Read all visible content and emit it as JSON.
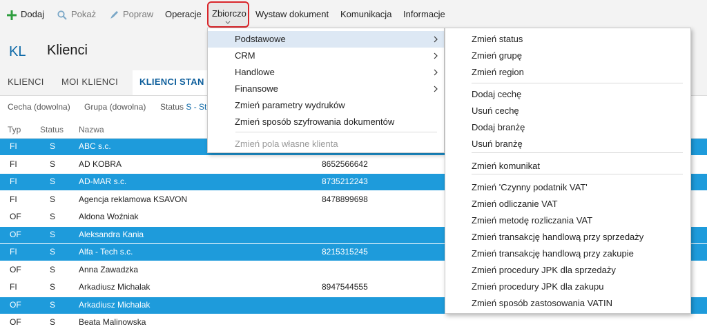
{
  "toolbar": {
    "add_label": "Dodaj",
    "show_label": "Pokaż",
    "edit_label": "Popraw",
    "operations_label": "Operacje",
    "bulk_label": "Zbiorczo",
    "issue_doc_label": "Wystaw dokument",
    "communication_label": "Komunikacja",
    "info_label": "Informacje",
    "add_icon": "plus-icon",
    "show_icon": "search-icon",
    "edit_icon": "pencil-icon",
    "accent_color": "#2e9e3e"
  },
  "header": {
    "badge": "KL",
    "title": "Klienci"
  },
  "tabs": [
    "KLIENCI",
    "MOI KLIENCI",
    "KLIENCI STAN"
  ],
  "filters": {
    "feature": "Cecha (dowolna)",
    "group": "Grupa (dowolna)",
    "status_label": "Status",
    "status_value": "S - St"
  },
  "columns": {
    "type": "Typ",
    "status": "Status",
    "name": "Nazwa"
  },
  "rows": [
    {
      "typ": "FI",
      "status": "S",
      "name": "ABC s.c.",
      "nip": "",
      "selected": true
    },
    {
      "typ": "FI",
      "status": "S",
      "name": "AD KOBRA",
      "nip": "8652566642",
      "selected": false
    },
    {
      "typ": "FI",
      "status": "S",
      "name": "AD-MAR s.c.",
      "nip": "8735212243",
      "selected": true
    },
    {
      "typ": "FI",
      "status": "S",
      "name": "Agencja reklamowa KSAVON",
      "nip": "8478899698",
      "selected": false
    },
    {
      "typ": "OF",
      "status": "S",
      "name": "Aldona Woźniak",
      "nip": "",
      "selected": false
    },
    {
      "typ": "OF",
      "status": "S",
      "name": "Aleksandra Kania",
      "nip": "",
      "selected": true
    },
    {
      "typ": "FI",
      "status": "S",
      "name": "Alfa - Tech s.c.",
      "nip": "8215315245",
      "selected": true
    },
    {
      "typ": "OF",
      "status": "S",
      "name": "Anna Zawadzka",
      "nip": "",
      "selected": false
    },
    {
      "typ": "FI",
      "status": "S",
      "name": "Arkadiusz Michalak",
      "nip": "8947544555",
      "selected": false
    },
    {
      "typ": "OF",
      "status": "S",
      "name": "Arkadiusz Michalak",
      "nip": "",
      "selected": true
    },
    {
      "typ": "OF",
      "status": "S",
      "name": "Beata Malinowska",
      "nip": "",
      "selected": false
    }
  ],
  "menu1": {
    "items": [
      {
        "label": "Podstawowe",
        "has_submenu": true
      },
      {
        "label": "CRM",
        "has_submenu": true
      },
      {
        "label": "Handlowe",
        "has_submenu": true
      },
      {
        "label": "Finansowe",
        "has_submenu": true
      },
      {
        "label": "Zmień parametry wydruków",
        "has_submenu": false
      },
      {
        "label": "Zmień sposób szyfrowania dokumentów",
        "has_submenu": false
      }
    ],
    "disabled_item": "Zmień pola własne klienta"
  },
  "menu2": {
    "items": [
      "Zmień status",
      "Zmień grupę",
      "Zmień region",
      "Dodaj cechę",
      "Usuń cechę",
      "Dodaj branżę",
      "Usuń branżę",
      "Zmień komunikat",
      "Zmień 'Czynny podatnik VAT'",
      "Zmień odliczanie VAT",
      "Zmień metodę rozliczania VAT",
      "Zmień transakcję handlową przy sprzedaży",
      "Zmień transakcję handlową przy zakupie",
      "Zmień procedury JPK dla sprzedaży",
      "Zmień procedury JPK dla zakupu",
      "Zmień sposób zastosowania VATIN"
    ]
  },
  "colors": {
    "selection": "#1e9bdb",
    "highlight": "#dde8f4",
    "focus_border": "#d9252a"
  }
}
